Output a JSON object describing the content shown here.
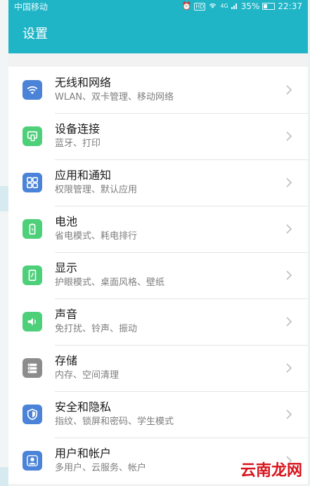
{
  "status": {
    "carrier": "中国移动",
    "hd": "HD",
    "signal": "4G",
    "battery": "35%",
    "time": "22:37"
  },
  "header": {
    "title": "设置"
  },
  "colors": {
    "header": "#1fb4c6",
    "blue": "#4a83d8",
    "green": "#4ed07a",
    "gray": "#8c8c8c"
  },
  "settings": [
    {
      "label": "无线和网络",
      "sub": "WLAN、双卡管理、移动网络",
      "icon": "wifi-icon",
      "color": "blue"
    },
    {
      "label": "设备连接",
      "sub": "蓝牙、打印",
      "icon": "device-connect-icon",
      "color": "green"
    },
    {
      "label": "应用和通知",
      "sub": "权限管理、默认应用",
      "icon": "apps-grid-icon",
      "color": "blue"
    },
    {
      "label": "电池",
      "sub": "省电模式、耗电排行",
      "icon": "battery-icon",
      "color": "green"
    },
    {
      "label": "显示",
      "sub": "护眼模式、桌面风格、壁纸",
      "icon": "display-icon",
      "color": "green"
    },
    {
      "label": "声音",
      "sub": "免打扰、铃声、振动",
      "icon": "speaker-icon",
      "color": "green"
    },
    {
      "label": "存储",
      "sub": "内存、空间清理",
      "icon": "storage-icon",
      "color": "gray"
    },
    {
      "label": "安全和隐私",
      "sub": "指纹、锁屏和密码、学生模式",
      "icon": "shield-icon",
      "color": "blue"
    },
    {
      "label": "用户和帐户",
      "sub": "多用户、云服务、帐户",
      "icon": "user-icon",
      "color": "blue"
    }
  ],
  "watermark": "云南龙网"
}
